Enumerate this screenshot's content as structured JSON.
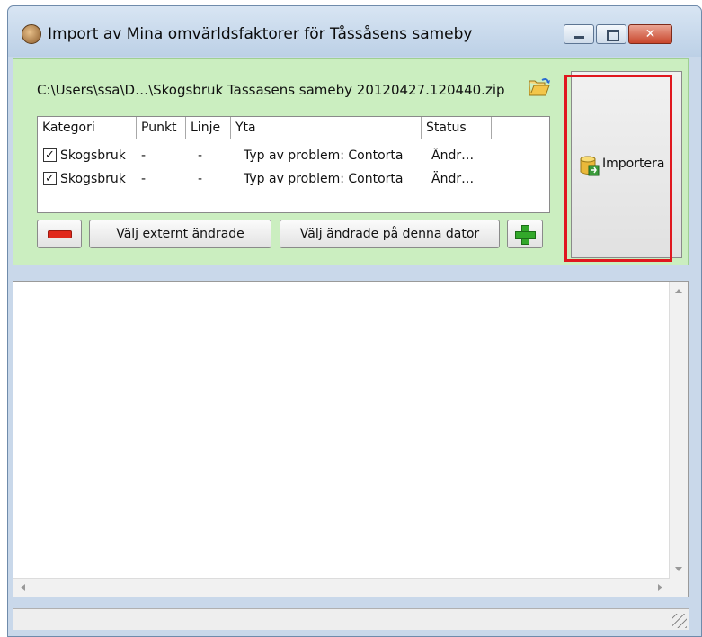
{
  "window": {
    "title": "Import av Mina omvärldsfaktorer för Tåssåsens sameby",
    "close_glyph": "✕",
    "icon": "app-icon"
  },
  "file": {
    "path": "C:\\Users\\ssa\\D…\\Skogsbruk Tassasens sameby 20120427.120440.zip",
    "browse_icon": "folder-open-icon"
  },
  "grid": {
    "columns": [
      "Kategori",
      "Punkt",
      "Linje",
      "Yta",
      "Status"
    ],
    "rows": [
      {
        "checked": true,
        "kategori": "Skogsbruk",
        "punkt": "-",
        "linje": "-",
        "yta": "Typ av problem: Contorta",
        "status": "Ändr…"
      },
      {
        "checked": true,
        "kategori": "Skogsbruk",
        "punkt": "-",
        "linje": "-",
        "yta": "Typ av problem: Contorta",
        "status": "Ändr…"
      }
    ]
  },
  "buttons": {
    "remove_icon": "minus-icon",
    "select_external": "Välj externt ändrade",
    "select_local": "Välj ändrade på denna dator",
    "add_icon": "plus-icon",
    "import": "Importera",
    "import_icon": "database-import-icon"
  },
  "highlight_color": "#e0171e",
  "panel_color": "#cbeec0"
}
